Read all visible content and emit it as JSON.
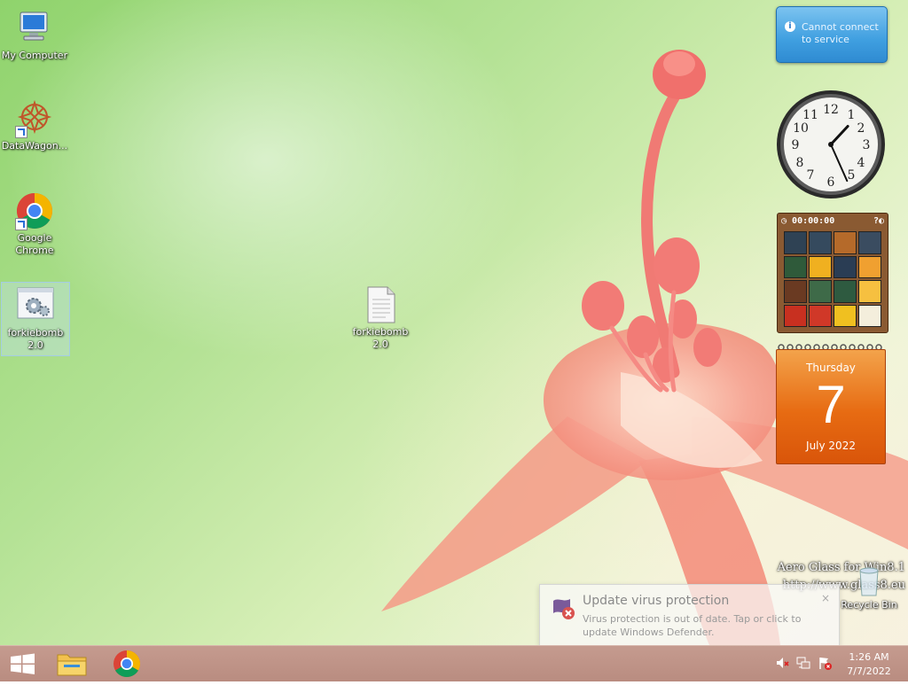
{
  "desktop": {
    "icons": [
      {
        "label": "My Computer"
      },
      {
        "label": "DataWagon..."
      },
      {
        "label": "Google Chrome"
      },
      {
        "label": "forkiebomb 2.0"
      },
      {
        "label": "forkiebomb 2.0"
      },
      {
        "label": "Recycle Bin"
      }
    ]
  },
  "gadgets": {
    "message": {
      "text": "Cannot connect to service"
    },
    "clock": {
      "hour": 1,
      "minute": 26
    },
    "puzzle": {
      "timer": "00:00:00"
    },
    "calendar": {
      "day_name": "Thursday",
      "day_number": "7",
      "month_year": "July 2022"
    }
  },
  "watermark": {
    "line1": "Aero Glass for Win8.1",
    "line2": "http://www.glass8.eu"
  },
  "notification": {
    "title": "Update virus protection",
    "body": "Virus protection is out of date. Tap or click to update Windows Defender.",
    "close": "×"
  },
  "taskbar": {
    "time": "1:26 AM",
    "date": "7/7/2022"
  },
  "colors": {
    "taskbar": "#bf9488",
    "calendar": "#e76b12",
    "gadget_blue": "#3f9fe0"
  }
}
